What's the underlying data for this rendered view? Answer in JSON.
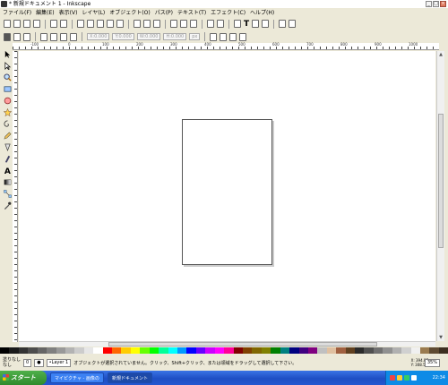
{
  "window": {
    "title": "* 新規ドキュメント 1 - Inkscape",
    "controls": [
      "_",
      "□",
      "×"
    ]
  },
  "menu": [
    "ファイル(F)",
    "編集(E)",
    "表示(V)",
    "レイヤ(L)",
    "オブジェクト(O)",
    "パス(P)",
    "テキスト(T)",
    "エフェクト(C)",
    "ヘルプ(H)"
  ],
  "toolbar2": {
    "x_field": "X:0.000",
    "y_field": "Y:0.000",
    "w_field": "W:0.000",
    "h_field": "H:0.000",
    "unit": "px"
  },
  "ruler_labels": [
    "-100",
    "0",
    "100",
    "200",
    "300",
    "400",
    "500",
    "600",
    "700",
    "800",
    "900",
    "1000",
    "1100"
  ],
  "palette": [
    "#000000",
    "#1a1a1a",
    "#333333",
    "#4d4d4d",
    "#666666",
    "#808080",
    "#999999",
    "#b3b3b3",
    "#cccccc",
    "#e6e6e6",
    "#ffffff",
    "#ff0000",
    "#ff6600",
    "#ffcc00",
    "#ffff00",
    "#66ff00",
    "#00ff00",
    "#00ff99",
    "#00ffff",
    "#0099ff",
    "#0000ff",
    "#6600ff",
    "#cc00ff",
    "#ff00ff",
    "#ff0099",
    "#800000",
    "#804000",
    "#806600",
    "#808000",
    "#008000",
    "#008080",
    "#000080",
    "#400080",
    "#800080",
    "#c0c0c0",
    "#e0c0a0",
    "#a06040",
    "#604020",
    "#2a2a2a",
    "#505050",
    "#707070",
    "#909090",
    "#b0b0b0",
    "#d0d0d0",
    "#f0f0f0",
    "#9a7b4f",
    "#5f4b32",
    "#3c2f20"
  ],
  "status": {
    "fill_label": "塗りなし",
    "stroke_label": "なし",
    "opacity": "0",
    "layer": "•Layer 1",
    "message": "オブジェクトが選択されていません。クリック、Shift+クリック、または領域をドラッグして選択して下さい。",
    "cursor_x": "X: 394.87",
    "cursor_y": "Y: 308.57",
    "zoom": "35%"
  },
  "taskbar": {
    "start": "スタート",
    "tasks": [
      "マイピクチャ - 画像の",
      "新規ドキュメント"
    ],
    "clock": "22:34"
  }
}
